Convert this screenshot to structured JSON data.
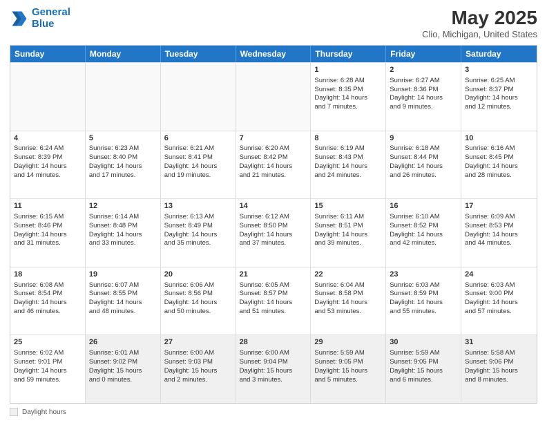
{
  "header": {
    "logo_line1": "General",
    "logo_line2": "Blue",
    "title": "May 2025",
    "subtitle": "Clio, Michigan, United States"
  },
  "days": [
    "Sunday",
    "Monday",
    "Tuesday",
    "Wednesday",
    "Thursday",
    "Friday",
    "Saturday"
  ],
  "footer": {
    "label": "Daylight hours"
  },
  "weeks": [
    [
      {
        "day": "",
        "info": ""
      },
      {
        "day": "",
        "info": ""
      },
      {
        "day": "",
        "info": ""
      },
      {
        "day": "",
        "info": ""
      },
      {
        "day": "1",
        "info": "Sunrise: 6:28 AM\nSunset: 8:35 PM\nDaylight: 14 hours\nand 7 minutes."
      },
      {
        "day": "2",
        "info": "Sunrise: 6:27 AM\nSunset: 8:36 PM\nDaylight: 14 hours\nand 9 minutes."
      },
      {
        "day": "3",
        "info": "Sunrise: 6:25 AM\nSunset: 8:37 PM\nDaylight: 14 hours\nand 12 minutes."
      }
    ],
    [
      {
        "day": "4",
        "info": "Sunrise: 6:24 AM\nSunset: 8:39 PM\nDaylight: 14 hours\nand 14 minutes."
      },
      {
        "day": "5",
        "info": "Sunrise: 6:23 AM\nSunset: 8:40 PM\nDaylight: 14 hours\nand 17 minutes."
      },
      {
        "day": "6",
        "info": "Sunrise: 6:21 AM\nSunset: 8:41 PM\nDaylight: 14 hours\nand 19 minutes."
      },
      {
        "day": "7",
        "info": "Sunrise: 6:20 AM\nSunset: 8:42 PM\nDaylight: 14 hours\nand 21 minutes."
      },
      {
        "day": "8",
        "info": "Sunrise: 6:19 AM\nSunset: 8:43 PM\nDaylight: 14 hours\nand 24 minutes."
      },
      {
        "day": "9",
        "info": "Sunrise: 6:18 AM\nSunset: 8:44 PM\nDaylight: 14 hours\nand 26 minutes."
      },
      {
        "day": "10",
        "info": "Sunrise: 6:16 AM\nSunset: 8:45 PM\nDaylight: 14 hours\nand 28 minutes."
      }
    ],
    [
      {
        "day": "11",
        "info": "Sunrise: 6:15 AM\nSunset: 8:46 PM\nDaylight: 14 hours\nand 31 minutes."
      },
      {
        "day": "12",
        "info": "Sunrise: 6:14 AM\nSunset: 8:48 PM\nDaylight: 14 hours\nand 33 minutes."
      },
      {
        "day": "13",
        "info": "Sunrise: 6:13 AM\nSunset: 8:49 PM\nDaylight: 14 hours\nand 35 minutes."
      },
      {
        "day": "14",
        "info": "Sunrise: 6:12 AM\nSunset: 8:50 PM\nDaylight: 14 hours\nand 37 minutes."
      },
      {
        "day": "15",
        "info": "Sunrise: 6:11 AM\nSunset: 8:51 PM\nDaylight: 14 hours\nand 39 minutes."
      },
      {
        "day": "16",
        "info": "Sunrise: 6:10 AM\nSunset: 8:52 PM\nDaylight: 14 hours\nand 42 minutes."
      },
      {
        "day": "17",
        "info": "Sunrise: 6:09 AM\nSunset: 8:53 PM\nDaylight: 14 hours\nand 44 minutes."
      }
    ],
    [
      {
        "day": "18",
        "info": "Sunrise: 6:08 AM\nSunset: 8:54 PM\nDaylight: 14 hours\nand 46 minutes."
      },
      {
        "day": "19",
        "info": "Sunrise: 6:07 AM\nSunset: 8:55 PM\nDaylight: 14 hours\nand 48 minutes."
      },
      {
        "day": "20",
        "info": "Sunrise: 6:06 AM\nSunset: 8:56 PM\nDaylight: 14 hours\nand 50 minutes."
      },
      {
        "day": "21",
        "info": "Sunrise: 6:05 AM\nSunset: 8:57 PM\nDaylight: 14 hours\nand 51 minutes."
      },
      {
        "day": "22",
        "info": "Sunrise: 6:04 AM\nSunset: 8:58 PM\nDaylight: 14 hours\nand 53 minutes."
      },
      {
        "day": "23",
        "info": "Sunrise: 6:03 AM\nSunset: 8:59 PM\nDaylight: 14 hours\nand 55 minutes."
      },
      {
        "day": "24",
        "info": "Sunrise: 6:03 AM\nSunset: 9:00 PM\nDaylight: 14 hours\nand 57 minutes."
      }
    ],
    [
      {
        "day": "25",
        "info": "Sunrise: 6:02 AM\nSunset: 9:01 PM\nDaylight: 14 hours\nand 59 minutes."
      },
      {
        "day": "26",
        "info": "Sunrise: 6:01 AM\nSunset: 9:02 PM\nDaylight: 15 hours\nand 0 minutes."
      },
      {
        "day": "27",
        "info": "Sunrise: 6:00 AM\nSunset: 9:03 PM\nDaylight: 15 hours\nand 2 minutes."
      },
      {
        "day": "28",
        "info": "Sunrise: 6:00 AM\nSunset: 9:04 PM\nDaylight: 15 hours\nand 3 minutes."
      },
      {
        "day": "29",
        "info": "Sunrise: 5:59 AM\nSunset: 9:05 PM\nDaylight: 15 hours\nand 5 minutes."
      },
      {
        "day": "30",
        "info": "Sunrise: 5:59 AM\nSunset: 9:05 PM\nDaylight: 15 hours\nand 6 minutes."
      },
      {
        "day": "31",
        "info": "Sunrise: 5:58 AM\nSunset: 9:06 PM\nDaylight: 15 hours\nand 8 minutes."
      }
    ]
  ]
}
